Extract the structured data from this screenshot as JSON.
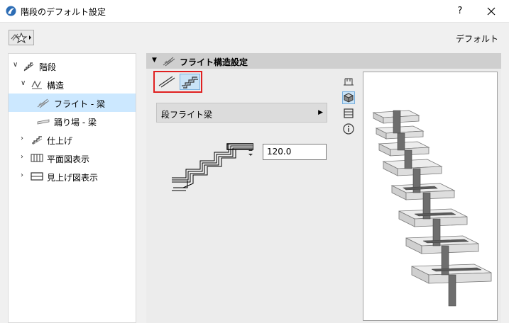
{
  "window": {
    "title": "階段のデフォルト設定",
    "help": "?",
    "icon": "archicad-app-icon"
  },
  "toolbar": {
    "favorites_icon": "favorites-star-icon",
    "default_label": "デフォルト"
  },
  "tree": {
    "items": [
      {
        "label": "階段",
        "icon": "stair-icon",
        "caret": "expanded",
        "level": 0
      },
      {
        "label": "構造",
        "icon": "structure-icon",
        "caret": "expanded",
        "level": 1
      },
      {
        "label": "フライト - 梁",
        "icon": "flight-beam-icon",
        "caret": "none",
        "level": 2,
        "selected": true
      },
      {
        "label": "踊り場 - 梁",
        "icon": "landing-beam-icon",
        "caret": "none",
        "level": 2
      },
      {
        "label": "仕上げ",
        "icon": "finish-icon",
        "caret": "collapsed",
        "level": 1
      },
      {
        "label": "平面図表示",
        "icon": "floor-plan-icon",
        "caret": "collapsed",
        "level": 1
      },
      {
        "label": "見上げ図表示",
        "icon": "reflected-ceiling-icon",
        "caret": "collapsed",
        "level": 1
      }
    ]
  },
  "panel": {
    "header": {
      "title": "フライト構造設定",
      "icon": "flight-structure-icon"
    },
    "modes": [
      {
        "name": "straight-stringer-icon",
        "active": false
      },
      {
        "name": "stepped-stringer-icon",
        "active": true
      }
    ],
    "flight_type": {
      "value": "段フライト梁"
    },
    "thickness": {
      "value": "120.0"
    },
    "view_buttons": [
      {
        "name": "floor-plan-view-icon",
        "active": false
      },
      {
        "name": "3d-view-icon",
        "active": true
      },
      {
        "name": "section-view-icon",
        "active": false
      },
      {
        "name": "info-icon",
        "active": false
      }
    ]
  },
  "colors": {
    "selection": "#cce8ff",
    "highlight_box": "#e02020",
    "active_button": "#c9e3f7"
  }
}
